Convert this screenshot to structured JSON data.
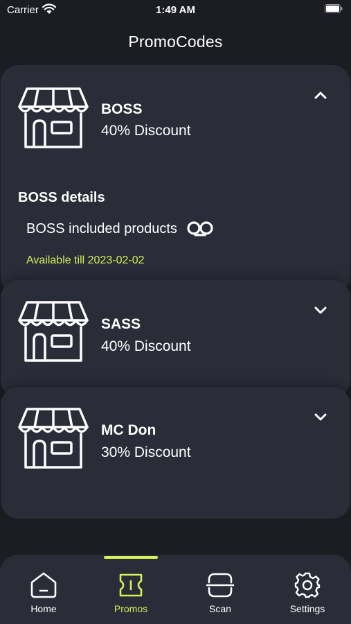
{
  "status": {
    "carrier": "Carrier",
    "time": "1:49 AM"
  },
  "header": {
    "title": "PromoCodes"
  },
  "promos": [
    {
      "name": "BOSS",
      "discount": "40% Discount",
      "expanded": true,
      "details_title": "BOSS details",
      "included_products": "BOSS included products",
      "available": "Available till 2023-02-02"
    },
    {
      "name": "SASS",
      "discount": "40% Discount",
      "expanded": false
    },
    {
      "name": "MC Don",
      "discount": "30% Discount",
      "expanded": false
    }
  ],
  "tabs": [
    {
      "label": "Home",
      "icon": "home-icon",
      "active": false
    },
    {
      "label": "Promos",
      "icon": "ticket-icon",
      "active": true
    },
    {
      "label": "Scan",
      "icon": "scan-icon",
      "active": false
    },
    {
      "label": "Settings",
      "icon": "gear-icon",
      "active": false
    }
  ],
  "colors": {
    "background": "#1c1d22",
    "card": "#2a2c38",
    "accent": "#d7f05a",
    "text": "#ffffff"
  }
}
